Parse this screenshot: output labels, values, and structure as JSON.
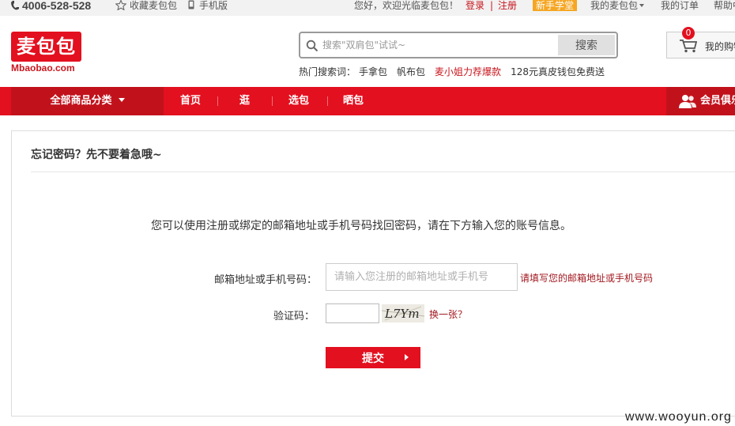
{
  "topbar": {
    "phone": "4006-528-528",
    "favorite": "收藏麦包包",
    "mobile": "手机版",
    "greeting": "您好，欢迎光临麦包包！",
    "login": "登录",
    "separator": "|",
    "register": "注册",
    "newbie": "新手学堂",
    "my_bag": "我的麦包包",
    "my_orders": "我的订单",
    "help": "帮助中"
  },
  "header": {
    "logo_text": "麦包包",
    "logo_sub": "Mbaobao.com",
    "search_placeholder": "搜索\"双肩包\"试试~",
    "search_button": "搜索",
    "hot_label": "热门搜索词：",
    "hot_terms": [
      "手拿包",
      "帆布包",
      "麦小姐力荐爆款",
      "128元真皮钱包免费送"
    ],
    "cart_count": "0",
    "cart_label": "我的购物"
  },
  "nav": {
    "all_categories": "全部商品分类",
    "links": [
      "首页",
      "逛",
      "选包",
      "晒包"
    ],
    "member": "会员俱乐"
  },
  "main": {
    "title": "忘记密码？先不要着急哦~",
    "instruction": "您可以使用注册或绑定的邮箱地址或手机号码找回密码，请在下方输入您的账号信息。",
    "email_label": "邮箱地址或手机号码：",
    "email_placeholder": "请输入您注册的邮箱地址或手机号",
    "email_hint": "请填写您的邮箱地址或手机号码",
    "code_label": "验证码：",
    "captcha_text": "L7Ym",
    "change_captcha": "换一张？",
    "submit": "提交"
  },
  "watermark": "www.wooyun.org",
  "colors": {
    "brand_red": "#e3101f",
    "dark_red": "#c1121c",
    "link_red": "#a2181f",
    "newbie_orange": "#f5a623"
  }
}
